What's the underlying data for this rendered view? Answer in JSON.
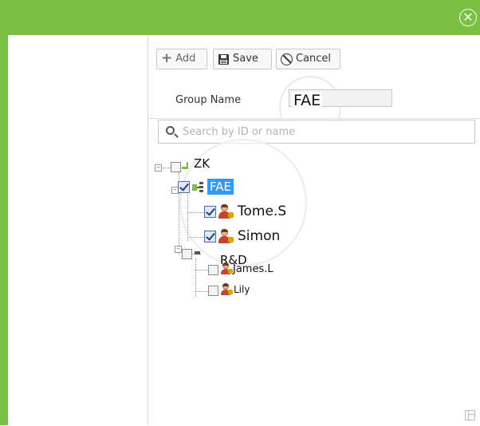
{
  "titlebar": {
    "close_icon": "close-circle-icon",
    "color": "#7ac143"
  },
  "toolbar": {
    "add_label": "Add",
    "save_label": "Save",
    "cancel_label": "Cancel",
    "add_icon": "plus-icon",
    "save_icon": "floppy-disk-icon",
    "cancel_icon": "cancel-circle-icon"
  },
  "form": {
    "group_name_label": "Group Name",
    "group_name_value": "FAE"
  },
  "search": {
    "placeholder": "Search by ID or name",
    "value": "",
    "icon": "search-icon"
  },
  "tree": {
    "root": {
      "label": "ZK",
      "checked": false
    },
    "departments": [
      {
        "label": "FAE",
        "checked": true,
        "selected": true,
        "members": [
          {
            "label": "Tome.S",
            "checked": true
          },
          {
            "label": "Simon",
            "checked": true
          }
        ]
      },
      {
        "label": "R&D",
        "checked": false,
        "selected": false,
        "members": [
          {
            "label": "James.L",
            "checked": false
          },
          {
            "label": "Lily",
            "checked": false
          }
        ]
      }
    ]
  },
  "selection_color": "#3399ff"
}
